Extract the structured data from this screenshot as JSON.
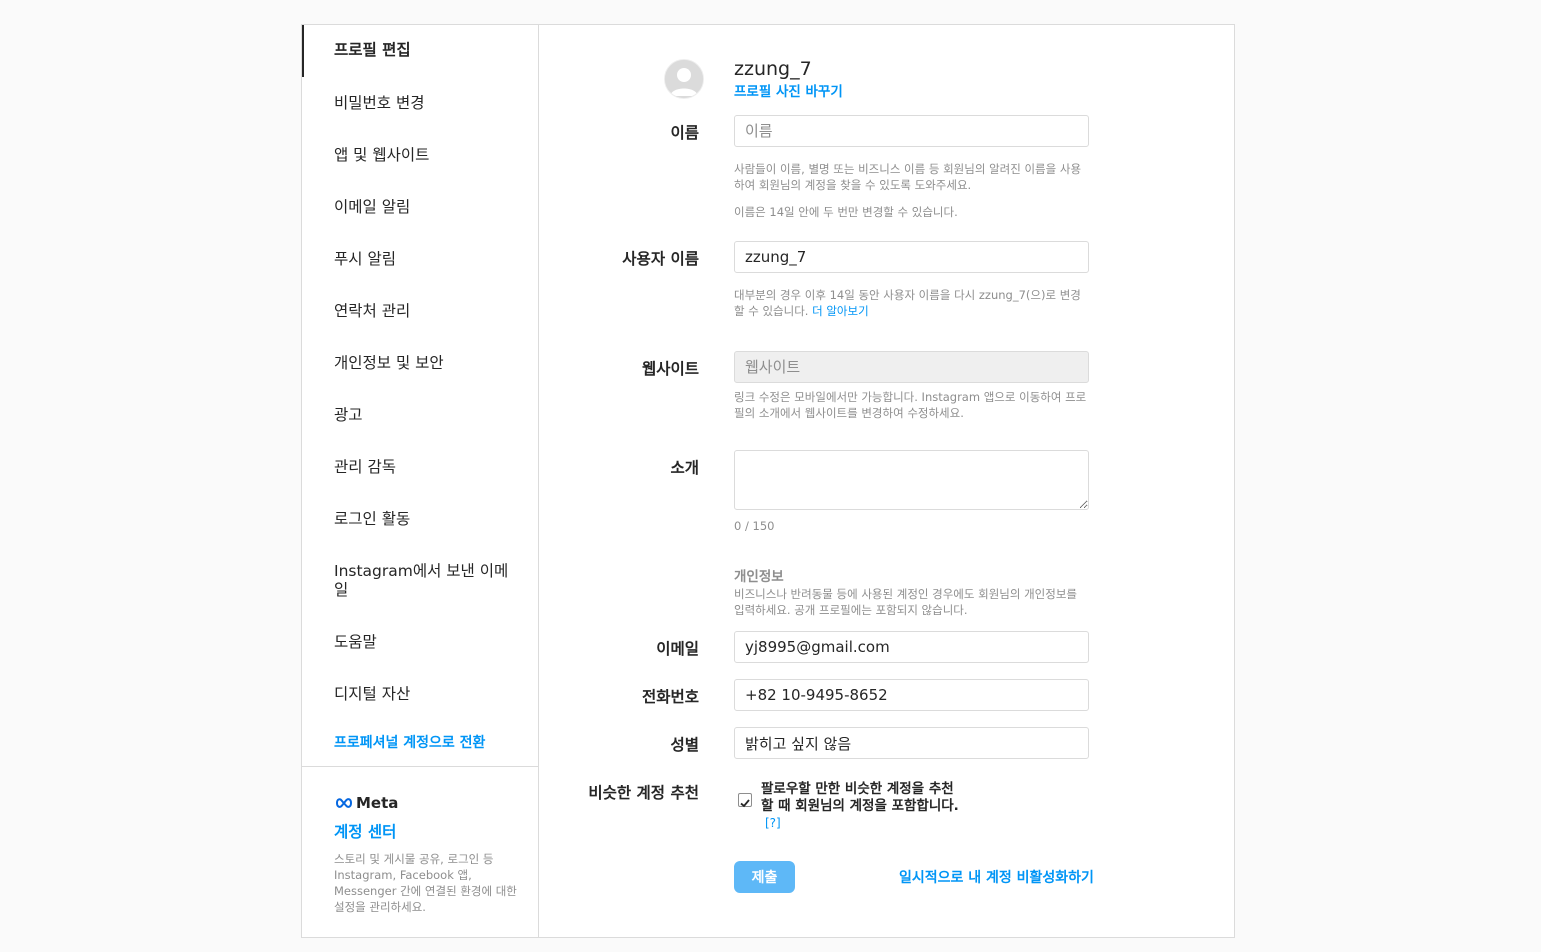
{
  "sidebar": {
    "items": [
      {
        "label": "프로필 편집",
        "name": "sidebar-item-edit-profile"
      },
      {
        "label": "비밀번호 변경",
        "name": "sidebar-item-change-password"
      },
      {
        "label": "앱 및 웹사이트",
        "name": "sidebar-item-apps-websites"
      },
      {
        "label": "이메일 알림",
        "name": "sidebar-item-email-notifications"
      },
      {
        "label": "푸시 알림",
        "name": "sidebar-item-push-notifications"
      },
      {
        "label": "연락처 관리",
        "name": "sidebar-item-contacts"
      },
      {
        "label": "개인정보 및 보안",
        "name": "sidebar-item-privacy-security"
      },
      {
        "label": "광고",
        "name": "sidebar-item-ads"
      },
      {
        "label": "관리 감독",
        "name": "sidebar-item-supervision"
      },
      {
        "label": "로그인 활동",
        "name": "sidebar-item-login-activity"
      },
      {
        "label": "Instagram에서 보낸 이메일",
        "name": "sidebar-item-emails-from-instagram"
      },
      {
        "label": "도움말",
        "name": "sidebar-item-help"
      },
      {
        "label": "디지털 자산",
        "name": "sidebar-item-digital-assets"
      }
    ],
    "pro_switch": "프로페셔널 계정으로 전환",
    "meta": {
      "logo_text": "Meta",
      "account_center": "계정 센터",
      "description": "스토리 및 게시물 공유, 로그인 등 Instagram, Facebook 앱, Messenger 간에 연결된 환경에 대한 설정을 관리하세요."
    }
  },
  "profile": {
    "username": "zzung_7",
    "change_photo": "프로필 사진 바꾸기"
  },
  "form": {
    "name": {
      "label": "이름",
      "placeholder": "이름",
      "value": "",
      "help1": "사람들이 이름, 별명 또는 비즈니스 이름 등 회원님의 알려진 이름을 사용하여 회원님의 계정을 찾을 수 있도록 도와주세요.",
      "help2": "이름은 14일 안에 두 번만 변경할 수 있습니다."
    },
    "username": {
      "label": "사용자 이름",
      "value": "zzung_7",
      "help": "대부분의 경우 이후 14일 동안 사용자 이름을 다시 zzung_7(으)로 변경할 수 있습니다.",
      "learn_more": "더 알아보기"
    },
    "website": {
      "label": "웹사이트",
      "placeholder": "웹사이트",
      "help": "링크 수정은 모바일에서만 가능합니다. Instagram 앱으로 이동하여 프로필의 소개에서 웹사이트를 변경하여 수정하세요."
    },
    "bio": {
      "label": "소개",
      "value": "",
      "counter": "0 / 150"
    },
    "personal_info": {
      "title": "개인정보",
      "help": "비즈니스나 반려동물 등에 사용된 계정인 경우에도 회원님의 개인정보를 입력하세요. 공개 프로필에는 포함되지 않습니다."
    },
    "email": {
      "label": "이메일",
      "value": "yj8995@gmail.com"
    },
    "phone": {
      "label": "전화번호",
      "value": "+82 10-9495-8652"
    },
    "gender": {
      "label": "성별",
      "value": "밝히고 싶지 않음"
    },
    "similar": {
      "label": "비슷한 계정 추천",
      "text": "팔로우할 만한 비슷한 계정을 추천할 때 회원님의 계정을 포함합니다.",
      "help_link": "[?]",
      "checked": true
    },
    "submit": "제출",
    "deactivate": "일시적으로 내 계정 비활성화하기"
  }
}
